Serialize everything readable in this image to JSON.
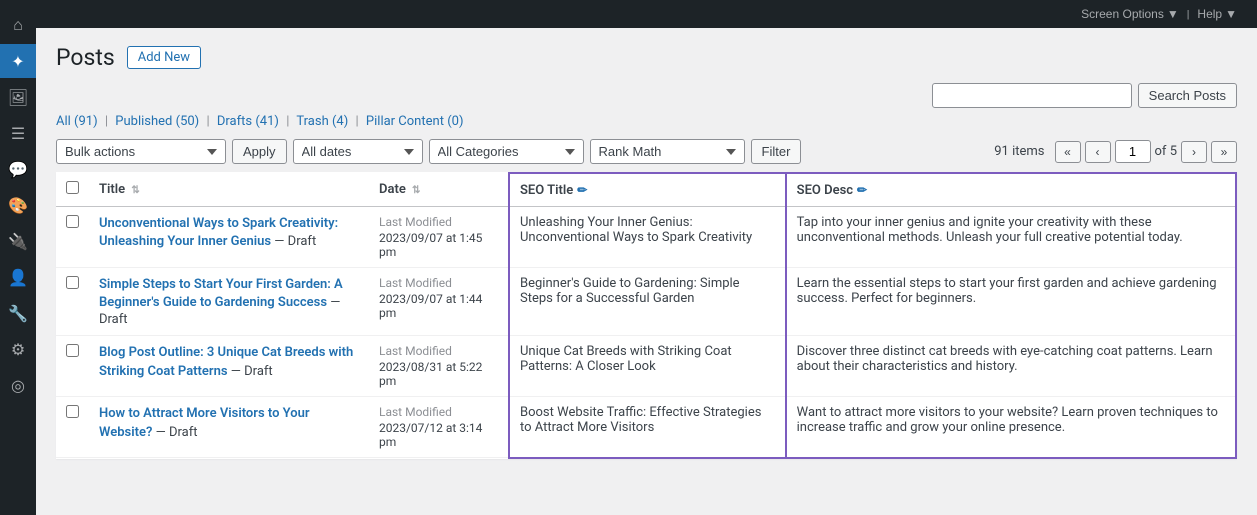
{
  "topbar": {
    "screen_options": "Screen Options",
    "screen_options_arrow": "▼",
    "help": "Help",
    "help_arrow": "▼"
  },
  "sidebar": {
    "icons": [
      "⌂",
      "✦",
      "☰",
      "⬒",
      "✎",
      "≡",
      "◎",
      "⚙",
      "👤",
      "🔧",
      "☰"
    ]
  },
  "header": {
    "title": "Posts",
    "add_new_label": "Add New"
  },
  "search": {
    "placeholder": "",
    "button_label": "Search Posts"
  },
  "filter_links": {
    "all_label": "All",
    "all_count": "(91)",
    "published_label": "Published",
    "published_count": "(50)",
    "drafts_label": "Drafts",
    "drafts_count": "(41)",
    "trash_label": "Trash",
    "trash_count": "(4)",
    "pillar_label": "Pillar Content",
    "pillar_count": "(0)"
  },
  "toolbar": {
    "bulk_actions_default": "Bulk actions",
    "all_dates_default": "All dates",
    "all_categories_default": "All Categories",
    "rank_math_default": "Rank Math",
    "apply_label": "Apply",
    "filter_label": "Filter"
  },
  "pagination": {
    "items_count": "91 items",
    "first_btn": "«",
    "prev_btn": "‹",
    "current_page": "1",
    "of_text": "of",
    "total_pages": "5",
    "next_btn": "›",
    "last_btn": "»"
  },
  "table": {
    "headers": {
      "cb": "",
      "title": "Title",
      "date": "Date",
      "seo_title": "SEO Title",
      "seo_desc": "SEO Desc"
    },
    "rows": [
      {
        "title": "Unconventional Ways to Spark Creativity: Unleashing Your Inner Genius",
        "status": "Draft",
        "date_label": "Last Modified",
        "date_value": "2023/09/07 at 1:45 pm",
        "seo_title": "Unleashing Your Inner Genius: Unconventional Ways to Spark Creativity",
        "seo_desc": "Tap into your inner genius and ignite your creativity with these unconventional methods. Unleash your full creative potential today."
      },
      {
        "title": "Simple Steps to Start Your First Garden: A Beginner's Guide to Gardening Success",
        "status": "Draft",
        "date_label": "Last Modified",
        "date_value": "2023/09/07 at 1:44 pm",
        "seo_title": "Beginner's Guide to Gardening: Simple Steps for a Successful Garden",
        "seo_desc": "Learn the essential steps to start your first garden and achieve gardening success. Perfect for beginners."
      },
      {
        "title": "Blog Post Outline: 3 Unique Cat Breeds with Striking Coat Patterns",
        "status": "Draft",
        "date_label": "Last Modified",
        "date_value": "2023/08/31 at 5:22 pm",
        "seo_title": "Unique Cat Breeds with Striking Coat Patterns: A Closer Look",
        "seo_desc": "Discover three distinct cat breeds with eye-catching coat patterns. Learn about their characteristics and history."
      },
      {
        "title": "How to Attract More Visitors to Your Website?",
        "status": "Draft",
        "date_label": "Last Modified",
        "date_value": "2023/07/12 at 3:14 pm",
        "seo_title": "Boost Website Traffic: Effective Strategies to Attract More Visitors",
        "seo_desc": "Want to attract more visitors to your website? Learn proven techniques to increase traffic and grow your online presence."
      }
    ]
  }
}
